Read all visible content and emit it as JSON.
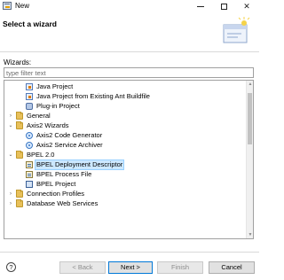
{
  "window": {
    "title": "New",
    "minimize_icon": "minimize-icon",
    "maximize_icon": "maximize-icon",
    "close_glyph": "✕"
  },
  "header": {
    "title": "Select a wizard",
    "banner_icon": "wizard-banner-icon"
  },
  "wizards": {
    "label": "Wizards:",
    "filter_placeholder": "type filter text",
    "filter_value": ""
  },
  "tree": {
    "items": [
      {
        "label": "Java Project",
        "icon": "java-project-icon",
        "expander": "",
        "depth": 1
      },
      {
        "label": "Java Project from Existing Ant Buildfile",
        "icon": "java-project-icon",
        "expander": "",
        "depth": 1
      },
      {
        "label": "Plug-in Project",
        "icon": "plugin-project-icon",
        "expander": "",
        "depth": 1
      },
      {
        "label": "General",
        "icon": "folder-icon",
        "expander": "collapsed",
        "depth": 0
      },
      {
        "label": "Axis2 Wizards",
        "icon": "folder-icon",
        "expander": "expanded",
        "depth": 0
      },
      {
        "label": "Axis2 Code Generator",
        "icon": "axis2-icon",
        "expander": "",
        "depth": 1
      },
      {
        "label": "Axis2 Service Archiver",
        "icon": "axis2-icon",
        "expander": "",
        "depth": 1
      },
      {
        "label": "BPEL 2.0",
        "icon": "folder-icon",
        "expander": "expanded",
        "depth": 0
      },
      {
        "label": "BPEL Deployment Descriptor",
        "icon": "bpel-file-icon",
        "expander": "",
        "depth": 1,
        "selected": true
      },
      {
        "label": "BPEL Process File",
        "icon": "bpel-file-icon",
        "expander": "",
        "depth": 1
      },
      {
        "label": "BPEL Project",
        "icon": "bpel-project-icon",
        "expander": "",
        "depth": 1
      },
      {
        "label": "Connection Profiles",
        "icon": "folder-icon",
        "expander": "collapsed",
        "depth": 0
      },
      {
        "label": "Database Web Services",
        "icon": "folder-icon",
        "expander": "collapsed",
        "depth": 0
      }
    ]
  },
  "footer": {
    "help_glyph": "?",
    "back_label": "< Back",
    "next_label": "Next >",
    "finish_label": "Finish",
    "cancel_label": "Cancel"
  }
}
